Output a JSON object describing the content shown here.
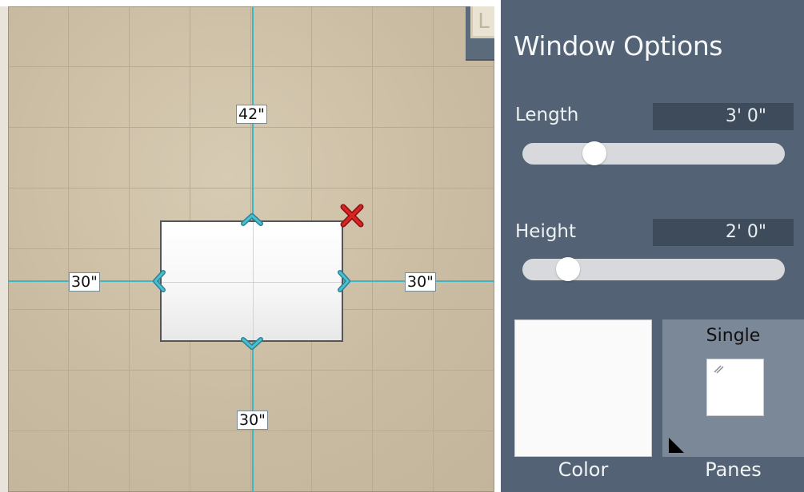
{
  "canvas": {
    "guide_color": "#3cb6c4",
    "dimensions": {
      "top": "42\"",
      "left": "30\"",
      "right": "30\"",
      "bottom": "30\""
    }
  },
  "panel": {
    "title": "Window Options",
    "length": {
      "label": "Length",
      "value": "3' 0\"",
      "slider_fraction": 0.25
    },
    "height": {
      "label": "Height",
      "value": "2' 0\"",
      "slider_fraction": 0.14
    },
    "color": {
      "caption": "Color",
      "selected": "#fafafa"
    },
    "panes": {
      "caption": "Panes",
      "value": "Single"
    }
  },
  "colors": {
    "panel_bg": "#536375",
    "value_box_bg": "#3e4b5a",
    "delete_red": "#cc1f1f"
  },
  "icons": [
    "arrow-up-icon",
    "arrow-down-icon",
    "arrow-left-icon",
    "arrow-right-icon",
    "delete-x-icon",
    "pane-glare-icon",
    "resize-corner-icon"
  ]
}
